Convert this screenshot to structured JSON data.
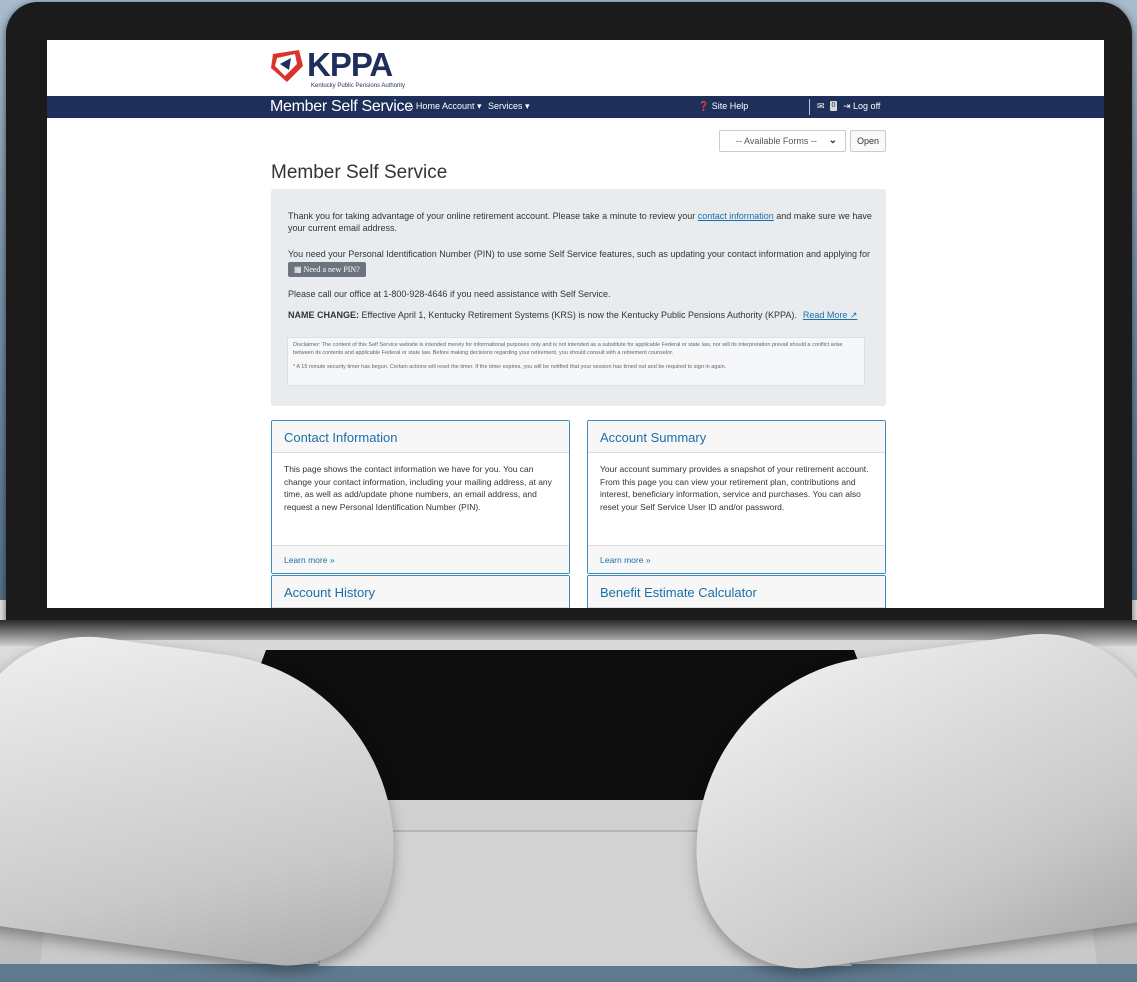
{
  "logo": {
    "name": "KPPA",
    "subtitle": "Kentucky Public Pensions Authority"
  },
  "navbar": {
    "brand": "Member Self Service",
    "home": "⌂ Home",
    "account": "Account ▾",
    "services": "Services ▾",
    "site_help": "❓ Site Help",
    "mail_icon": "✉",
    "mail_count": "0",
    "logoff": "⇥ Log off"
  },
  "forms": {
    "select_value": "-- Available Forms --",
    "open_label": "Open"
  },
  "page_title": "Member Self Service",
  "intro": {
    "p1_before": "Thank you for taking advantage of your online retirement account. Please take a minute to review your ",
    "p1_link": "contact information",
    "p1_after": " and make sure we have your current email address.",
    "p2": "You need your Personal Identification Number (PIN) to use some Self Service features, such as updating your contact information and applying for retirement.",
    "pin_button": "▦ Need a new PIN?",
    "p3": "Please call our office at 1-800-928-4646 if you need assistance with Self Service.",
    "p4_strong": "NAME CHANGE:",
    "p4_text": " Effective April 1, Kentucky Retirement Systems (KRS) is now the Kentucky Public Pensions Authority (KPPA).",
    "read_more": "Read More ↗",
    "disclaimer": "Disclaimer: The content of this Self Service website is intended merely for informational purposes only and is not intended as a substitute for applicable Federal or state law, nor will its interpretation prevail should a conflict arise between its contents and applicable Federal or state law. Before making decisions regarding your retirement, you should consult with a retirement counselor.",
    "timer": "* A 15 minute security timer has begun. Certain actions will reset the timer. If the timer expires, you will be notified that your session has timed out and be required to sign in again."
  },
  "cards": [
    {
      "title": "Contact Information",
      "body": "This page shows the contact information we have for you. You can change your contact information, including your mailing address, at any time, as well as add/update phone numbers, an email address, and request a new Personal Identification Number (PIN).",
      "link": "Learn more »"
    },
    {
      "title": "Account Summary",
      "body": "Your account summary provides a snapshot of your retirement account. From this page you can view your retirement plan, contributions and interest, beneficiary information, service and purchases. You can also reset your Self Service User ID and/or password.",
      "link": "Learn more »"
    },
    {
      "title": "Account History"
    },
    {
      "title": "Benefit Estimate Calculator"
    }
  ],
  "colors": {
    "navbar": "#1e2f59",
    "link": "#1a6fa8",
    "card_border": "#3c8dbc",
    "logo_red": "#d9342b"
  }
}
